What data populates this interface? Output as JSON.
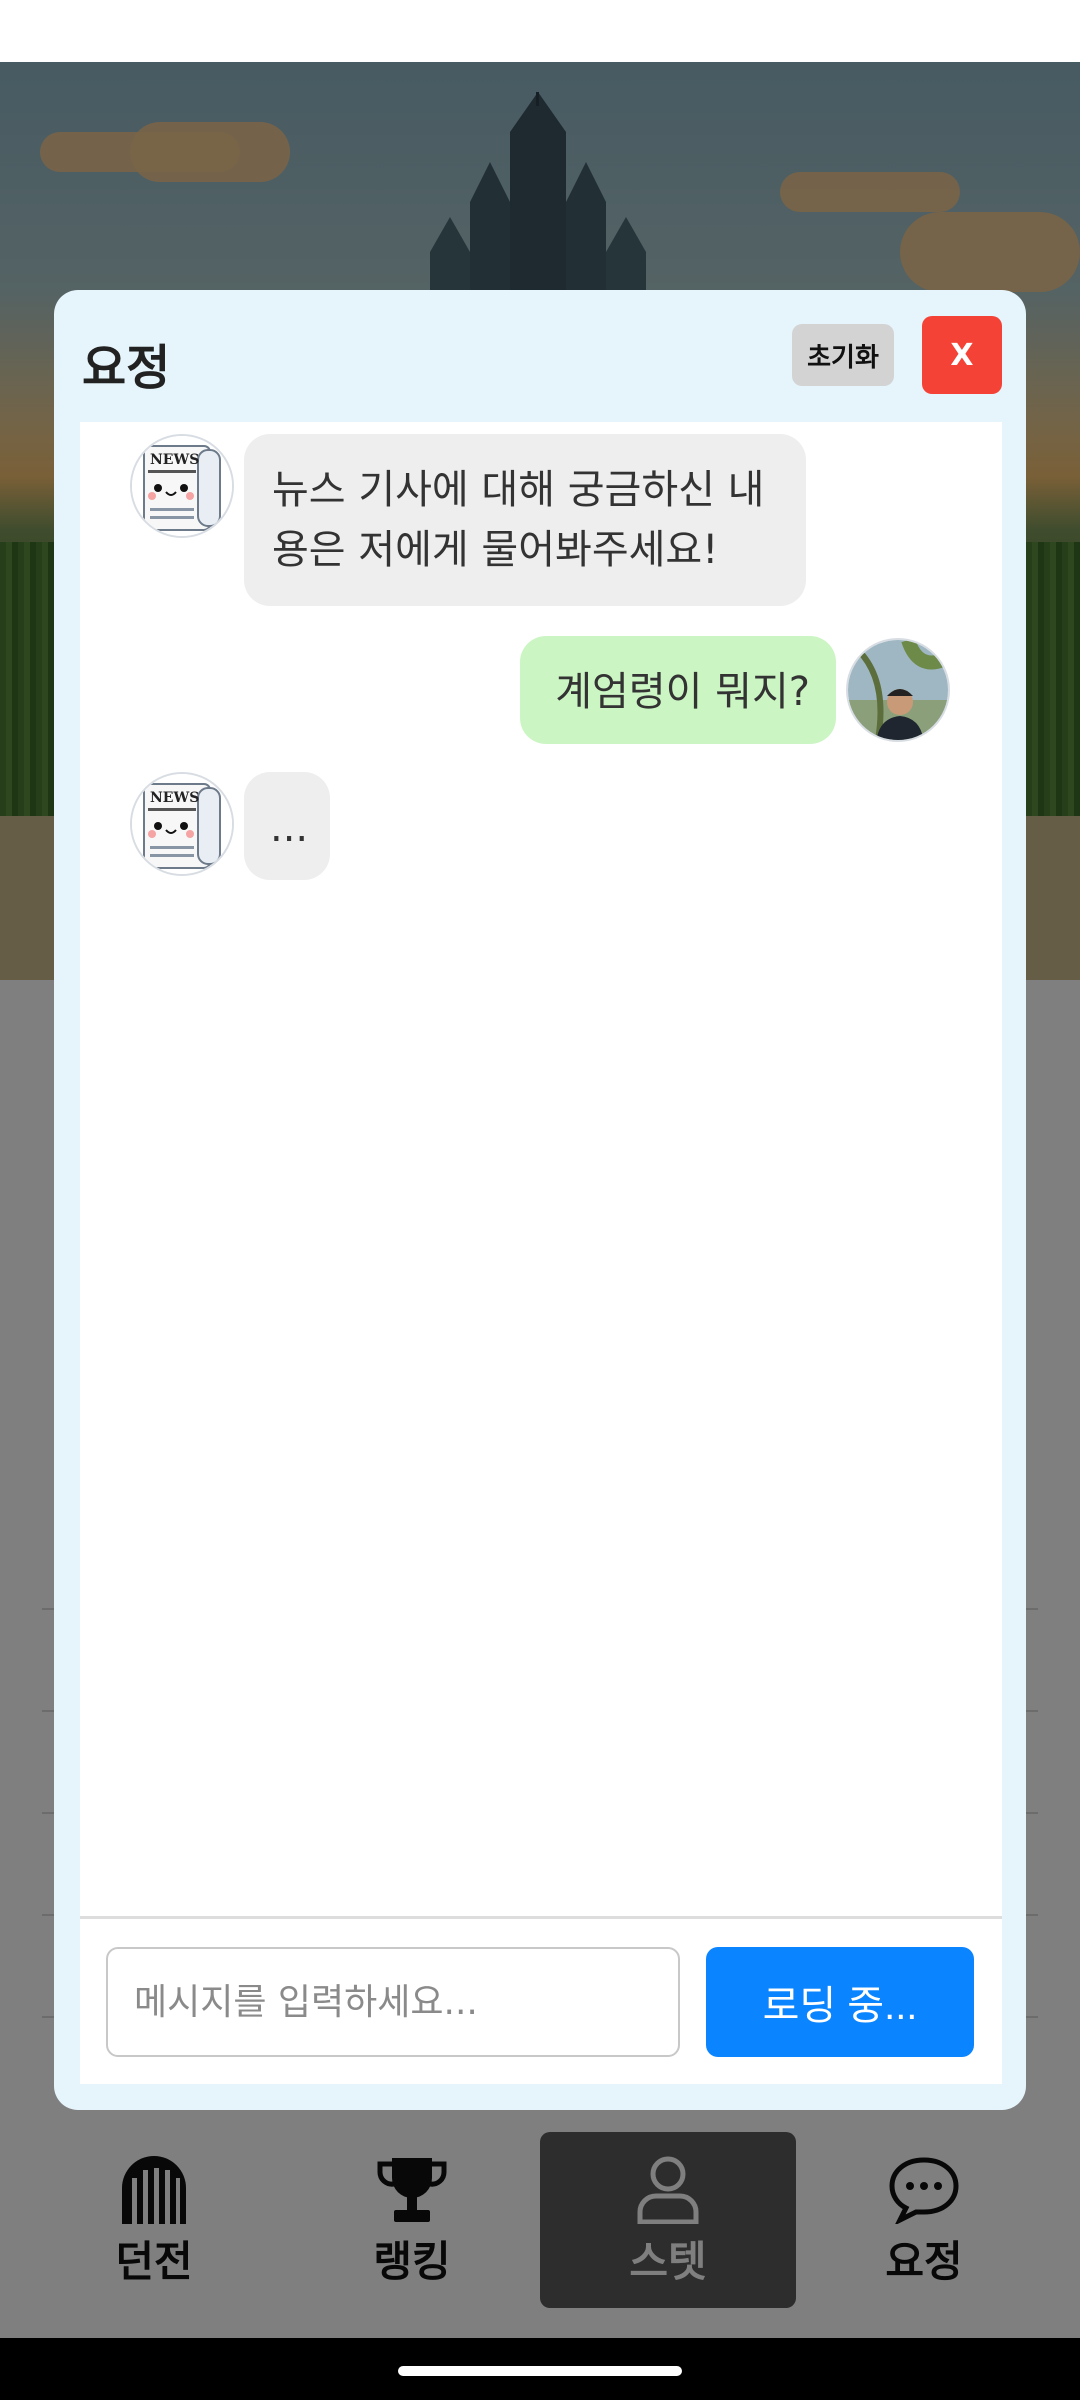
{
  "dialog": {
    "title": "요정",
    "reset_label": "초기화",
    "close_label": "X"
  },
  "messages": [
    {
      "role": "bot",
      "text": "뉴스 기사에 대해 궁금하신 내용은 저에게 물어봐주세요!",
      "avatar": "news-mascot"
    },
    {
      "role": "user",
      "text": "계엄령이 뭐지?",
      "avatar": "user-photo"
    },
    {
      "role": "bot",
      "text": "...",
      "avatar": "news-mascot"
    }
  ],
  "composer": {
    "placeholder": "메시지를 입력하세요...",
    "send_label": "로딩 중..."
  },
  "bottom_nav": {
    "items": [
      {
        "label": "던전",
        "icon": "dungeon-gate-icon",
        "active": false
      },
      {
        "label": "랭킹",
        "icon": "trophy-icon",
        "active": false
      },
      {
        "label": "스텟",
        "icon": "person-icon",
        "active": true
      },
      {
        "label": "요정",
        "icon": "chat-bubble-icon",
        "active": false
      }
    ]
  },
  "colors": {
    "modal_bg": "#e6f4fb",
    "close_button": "#f44336",
    "send_button": "#0a84ff",
    "user_bubble": "#ccf5c4",
    "bot_bubble": "#eeeeee"
  }
}
